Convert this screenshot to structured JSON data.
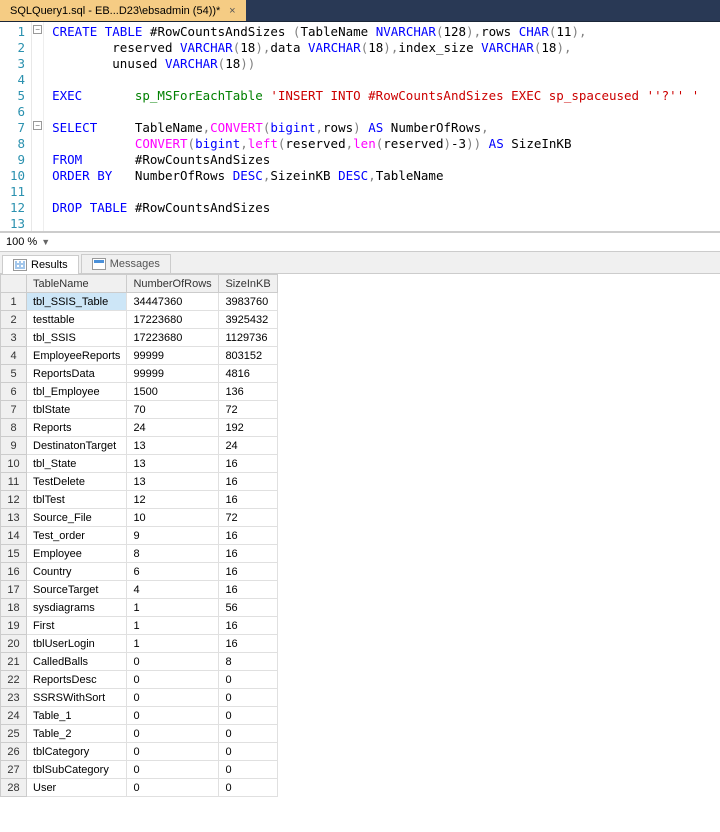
{
  "tab": {
    "title": "SQLQuery1.sql - EB...D23\\ebsadmin (54))*"
  },
  "zoom": "100 %",
  "code": {
    "lines": [
      "CREATE TABLE #RowCountsAndSizes (TableName NVARCHAR(128),rows CHAR(11),",
      "        reserved VARCHAR(18),data VARCHAR(18),index_size VARCHAR(18),",
      "        unused VARCHAR(18))",
      "",
      "EXEC       sp_MSForEachTable 'INSERT INTO #RowCountsAndSizes EXEC sp_spaceused ''?'' '",
      "",
      "SELECT     TableName,CONVERT(bigint,rows) AS NumberOfRows,",
      "           CONVERT(bigint,left(reserved,len(reserved)-3)) AS SizeInKB",
      "FROM       #RowCountsAndSizes",
      "ORDER BY   NumberOfRows DESC,SizeinKB DESC,TableName",
      "",
      "DROP TABLE #RowCountsAndSizes",
      ""
    ]
  },
  "resultsTabs": {
    "results": "Results",
    "messages": "Messages"
  },
  "columns": [
    "TableName",
    "NumberOfRows",
    "SizeInKB"
  ],
  "rows": [
    {
      "n": "1",
      "c": [
        "tbl_SSIS_Table",
        "34447360",
        "3983760"
      ]
    },
    {
      "n": "2",
      "c": [
        "testtable",
        "17223680",
        "3925432"
      ]
    },
    {
      "n": "3",
      "c": [
        "tbl_SSIS",
        "17223680",
        "1129736"
      ]
    },
    {
      "n": "4",
      "c": [
        "EmployeeReports",
        "99999",
        "803152"
      ]
    },
    {
      "n": "5",
      "c": [
        "ReportsData",
        "99999",
        "4816"
      ]
    },
    {
      "n": "6",
      "c": [
        "tbl_Employee",
        "1500",
        "136"
      ]
    },
    {
      "n": "7",
      "c": [
        "tblState",
        "70",
        "72"
      ]
    },
    {
      "n": "8",
      "c": [
        "Reports",
        "24",
        "192"
      ]
    },
    {
      "n": "9",
      "c": [
        "DestinatonTarget",
        "13",
        "24"
      ]
    },
    {
      "n": "10",
      "c": [
        "tbl_State",
        "13",
        "16"
      ]
    },
    {
      "n": "11",
      "c": [
        "TestDelete",
        "13",
        "16"
      ]
    },
    {
      "n": "12",
      "c": [
        "tblTest",
        "12",
        "16"
      ]
    },
    {
      "n": "13",
      "c": [
        "Source_File",
        "10",
        "72"
      ]
    },
    {
      "n": "14",
      "c": [
        "Test_order",
        "9",
        "16"
      ]
    },
    {
      "n": "15",
      "c": [
        "Employee",
        "8",
        "16"
      ]
    },
    {
      "n": "16",
      "c": [
        "Country",
        "6",
        "16"
      ]
    },
    {
      "n": "17",
      "c": [
        "SourceTarget",
        "4",
        "16"
      ]
    },
    {
      "n": "18",
      "c": [
        "sysdiagrams",
        "1",
        "56"
      ]
    },
    {
      "n": "19",
      "c": [
        "First",
        "1",
        "16"
      ]
    },
    {
      "n": "20",
      "c": [
        "tblUserLogin",
        "1",
        "16"
      ]
    },
    {
      "n": "21",
      "c": [
        "CalledBalls",
        "0",
        "8"
      ]
    },
    {
      "n": "22",
      "c": [
        "ReportsDesc",
        "0",
        "0"
      ]
    },
    {
      "n": "23",
      "c": [
        "SSRSWithSort",
        "0",
        "0"
      ]
    },
    {
      "n": "24",
      "c": [
        "Table_1",
        "0",
        "0"
      ]
    },
    {
      "n": "25",
      "c": [
        "Table_2",
        "0",
        "0"
      ]
    },
    {
      "n": "26",
      "c": [
        "tblCategory",
        "0",
        "0"
      ]
    },
    {
      "n": "27",
      "c": [
        "tblSubCategory",
        "0",
        "0"
      ]
    },
    {
      "n": "28",
      "c": [
        "User",
        "0",
        "0"
      ]
    }
  ]
}
